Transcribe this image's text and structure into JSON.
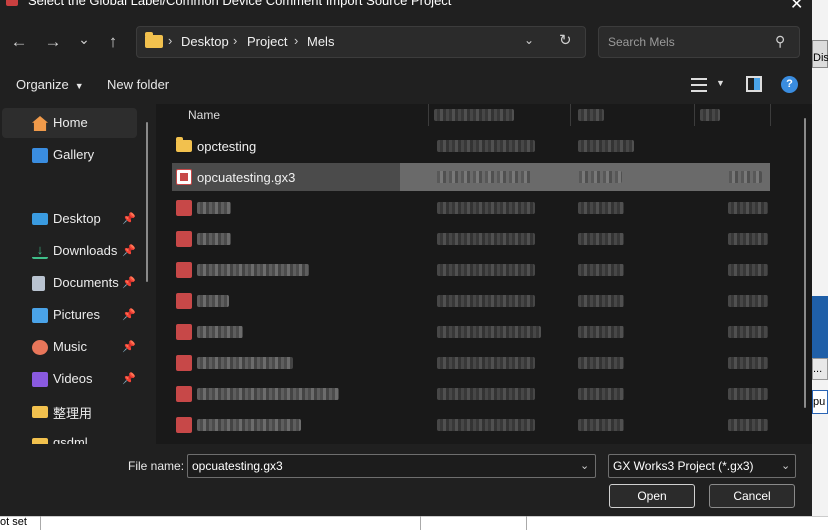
{
  "window": {
    "title": "Select the Global Label/Common Device Comment Import Source Project",
    "close_glyph": "✕"
  },
  "nav": {
    "back_glyph": "←",
    "forward_glyph": "→",
    "recent_glyph": "⌄",
    "up_glyph": "↑",
    "breadcrumbs": [
      "Desktop",
      "Project",
      "Mels"
    ],
    "separator": "›",
    "dropdown_glyph": "⌄",
    "refresh_glyph": "↻",
    "search_placeholder": "Search Mels",
    "search_glyph": "⚲"
  },
  "toolbar": {
    "organize_label": "Organize",
    "organize_caret": "▼",
    "new_folder_label": "New folder",
    "view_caret": "▼",
    "help_glyph": "?"
  },
  "sidebar": {
    "items": [
      {
        "label": "Home",
        "icon": "home-icon",
        "color": "#f09a4a"
      },
      {
        "label": "Gallery",
        "icon": "gallery-icon",
        "color": "#3a8de0"
      },
      {
        "label": "Desktop",
        "icon": "desktop-icon",
        "color": "#3a9be0"
      },
      {
        "label": "Downloads",
        "icon": "download-icon",
        "color": "#3fbf8a"
      },
      {
        "label": "Documents",
        "icon": "documents-icon",
        "color": "#b9c3d0"
      },
      {
        "label": "Pictures",
        "icon": "pictures-icon",
        "color": "#4aa3e8"
      },
      {
        "label": "Music",
        "icon": "music-icon",
        "color": "#e8765a"
      },
      {
        "label": "Videos",
        "icon": "videos-icon",
        "color": "#8a5ae0"
      },
      {
        "label": "整理用",
        "icon": "folder-icon",
        "color": "#f2c14e"
      },
      {
        "label": "gsdml",
        "icon": "folder-icon",
        "color": "#f2c14e"
      }
    ],
    "pin_glyph": "📌"
  },
  "filelist": {
    "name_header": "Name",
    "sort_glyph": "^",
    "rows": [
      {
        "label": "opctesting",
        "type": "folder"
      },
      {
        "label": "opcuatesting.gx3",
        "type": "gx3",
        "selected": true
      }
    ]
  },
  "bottom": {
    "file_name_label": "File name:",
    "file_name_value": "opcuatesting.gx3",
    "filter_value": "GX Works3 Project (*.gx3)",
    "dropdown_glyph": "⌄",
    "open_label": "Open",
    "cancel_label": "Cancel"
  },
  "background_app": {
    "right_text": "Dis",
    "strip_text": "...",
    "strip_text2": "pu",
    "bottom_text": "ot set"
  }
}
